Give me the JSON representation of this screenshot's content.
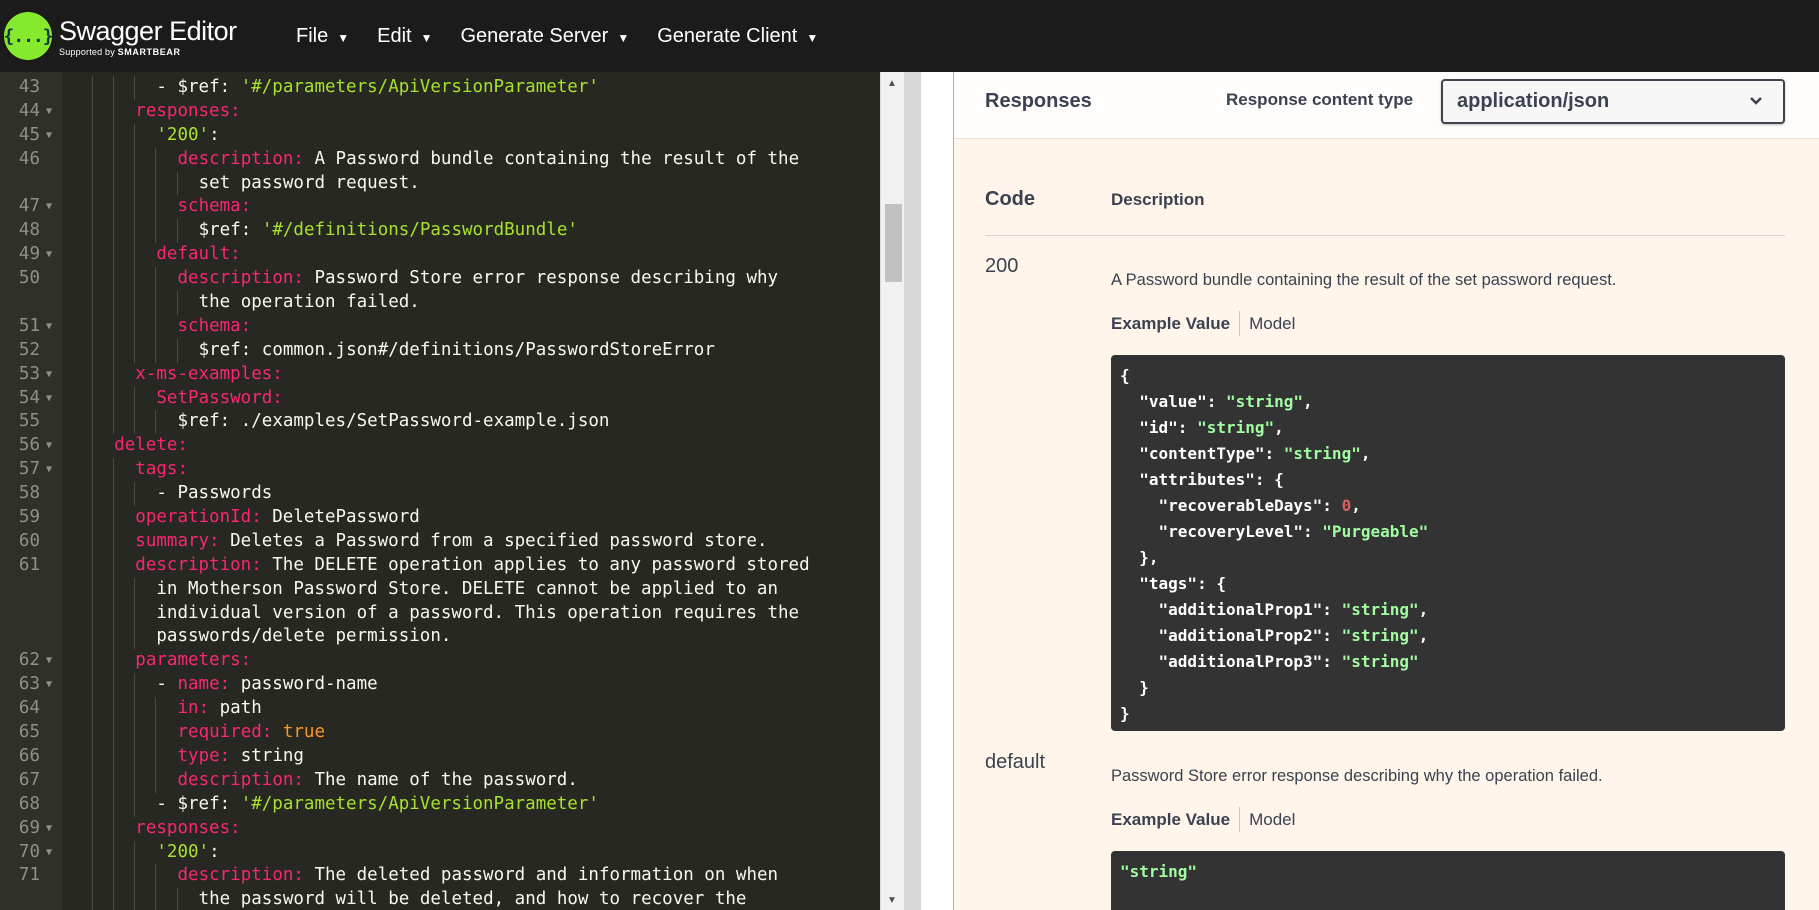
{
  "app": {
    "logo_glyph": "{...}",
    "title": "Swagger Editor",
    "supported_by": "Supported by",
    "brand": "SMARTBEAR",
    "accent_color": "#85ea2d"
  },
  "menu": [
    {
      "label": "File"
    },
    {
      "label": "Edit"
    },
    {
      "label": "Generate Server"
    },
    {
      "label": "Generate Client"
    }
  ],
  "editor": {
    "lines": [
      {
        "n": "43",
        "fold": false,
        "indent": 4,
        "tokens": [
          [
            "p",
            "- $ref: "
          ],
          [
            "s",
            "'#/parameters/ApiVersionParameter'"
          ]
        ]
      },
      {
        "n": "44",
        "fold": true,
        "indent": 3,
        "tokens": [
          [
            "k",
            "responses:"
          ]
        ]
      },
      {
        "n": "45",
        "fold": true,
        "indent": 4,
        "tokens": [
          [
            "s",
            "'200'"
          ],
          [
            "p",
            ":"
          ]
        ]
      },
      {
        "n": "46",
        "fold": false,
        "indent": 5,
        "tokens": [
          [
            "k",
            "description:"
          ],
          [
            "p",
            " A Password bundle containing the result of the"
          ]
        ]
      },
      {
        "n": "",
        "fold": false,
        "indent": 6,
        "tokens": [
          [
            "p",
            "set password request."
          ]
        ]
      },
      {
        "n": "47",
        "fold": true,
        "indent": 5,
        "tokens": [
          [
            "k",
            "schema:"
          ]
        ]
      },
      {
        "n": "48",
        "fold": false,
        "indent": 6,
        "tokens": [
          [
            "p",
            "$ref: "
          ],
          [
            "s",
            "'#/definitions/PasswordBundle'"
          ]
        ]
      },
      {
        "n": "49",
        "fold": true,
        "indent": 4,
        "tokens": [
          [
            "k",
            "default:"
          ]
        ]
      },
      {
        "n": "50",
        "fold": false,
        "indent": 5,
        "tokens": [
          [
            "k",
            "description:"
          ],
          [
            "p",
            " Password Store error response describing why"
          ]
        ]
      },
      {
        "n": "",
        "fold": false,
        "indent": 6,
        "tokens": [
          [
            "p",
            "the operation failed."
          ]
        ]
      },
      {
        "n": "51",
        "fold": true,
        "indent": 5,
        "tokens": [
          [
            "k",
            "schema:"
          ]
        ]
      },
      {
        "n": "52",
        "fold": false,
        "indent": 6,
        "tokens": [
          [
            "p",
            "$ref: common.json#/definitions/PasswordStoreError"
          ]
        ]
      },
      {
        "n": "53",
        "fold": true,
        "indent": 3,
        "tokens": [
          [
            "k",
            "x-ms-examples:"
          ]
        ]
      },
      {
        "n": "54",
        "fold": true,
        "indent": 4,
        "tokens": [
          [
            "k",
            "SetPassword:"
          ]
        ]
      },
      {
        "n": "55",
        "fold": false,
        "indent": 5,
        "tokens": [
          [
            "p",
            "$ref: ./examples/SetPassword-example.json"
          ]
        ]
      },
      {
        "n": "56",
        "fold": true,
        "indent": 2,
        "tokens": [
          [
            "k",
            "delete:"
          ]
        ]
      },
      {
        "n": "57",
        "fold": true,
        "indent": 3,
        "tokens": [
          [
            "k",
            "tags:"
          ]
        ]
      },
      {
        "n": "58",
        "fold": false,
        "indent": 4,
        "tokens": [
          [
            "p",
            "- Passwords"
          ]
        ]
      },
      {
        "n": "59",
        "fold": false,
        "indent": 3,
        "tokens": [
          [
            "k",
            "operationId:"
          ],
          [
            "p",
            " DeletePassword"
          ]
        ]
      },
      {
        "n": "60",
        "fold": false,
        "indent": 3,
        "tokens": [
          [
            "k",
            "summary:"
          ],
          [
            "p",
            " Deletes a Password from a specified password store."
          ]
        ]
      },
      {
        "n": "61",
        "fold": false,
        "indent": 3,
        "tokens": [
          [
            "k",
            "description:"
          ],
          [
            "p",
            " The DELETE operation applies to any password stored"
          ]
        ]
      },
      {
        "n": "",
        "fold": false,
        "indent": 4,
        "tokens": [
          [
            "p",
            "in Motherson Password Store. DELETE cannot be applied to an"
          ]
        ]
      },
      {
        "n": "",
        "fold": false,
        "indent": 4,
        "tokens": [
          [
            "p",
            "individual version of a password. This operation requires the"
          ]
        ]
      },
      {
        "n": "",
        "fold": false,
        "indent": 4,
        "tokens": [
          [
            "p",
            "passwords/delete permission."
          ]
        ]
      },
      {
        "n": "62",
        "fold": true,
        "indent": 3,
        "tokens": [
          [
            "k",
            "parameters:"
          ]
        ]
      },
      {
        "n": "63",
        "fold": true,
        "indent": 4,
        "tokens": [
          [
            "p",
            "- "
          ],
          [
            "k",
            "name:"
          ],
          [
            "p",
            " password-name"
          ]
        ]
      },
      {
        "n": "64",
        "fold": false,
        "indent": 5,
        "tokens": [
          [
            "k",
            "in:"
          ],
          [
            "p",
            " path"
          ]
        ]
      },
      {
        "n": "65",
        "fold": false,
        "indent": 5,
        "tokens": [
          [
            "k",
            "required:"
          ],
          [
            "b",
            " true"
          ]
        ]
      },
      {
        "n": "66",
        "fold": false,
        "indent": 5,
        "tokens": [
          [
            "k",
            "type:"
          ],
          [
            "p",
            " string"
          ]
        ]
      },
      {
        "n": "67",
        "fold": false,
        "indent": 5,
        "tokens": [
          [
            "k",
            "description:"
          ],
          [
            "p",
            " The name of the password."
          ]
        ]
      },
      {
        "n": "68",
        "fold": false,
        "indent": 4,
        "tokens": [
          [
            "p",
            "- $ref: "
          ],
          [
            "s",
            "'#/parameters/ApiVersionParameter'"
          ]
        ]
      },
      {
        "n": "69",
        "fold": true,
        "indent": 3,
        "tokens": [
          [
            "k",
            "responses:"
          ]
        ]
      },
      {
        "n": "70",
        "fold": true,
        "indent": 4,
        "tokens": [
          [
            "s",
            "'200'"
          ],
          [
            "p",
            ":"
          ]
        ]
      },
      {
        "n": "71",
        "fold": false,
        "indent": 5,
        "tokens": [
          [
            "k",
            "description:"
          ],
          [
            "p",
            " The deleted password and information on when"
          ]
        ]
      },
      {
        "n": "",
        "fold": false,
        "indent": 6,
        "tokens": [
          [
            "p",
            "the password will be deleted, and how to recover the"
          ]
        ]
      }
    ]
  },
  "responses": {
    "title": "Responses",
    "content_type_label": "Response content type",
    "content_type_value": "application/json",
    "col_code": "Code",
    "col_description": "Description",
    "example_tab": "Example Value",
    "model_tab": "Model",
    "rows": [
      {
        "code": "200",
        "description": "A Password bundle containing the result of the set password request.",
        "example_lines": [
          [
            [
              "p",
              "{"
            ]
          ],
          [
            [
              "p",
              "  "
            ],
            [
              "k",
              "\"value\""
            ],
            [
              "p",
              ": "
            ],
            [
              "s",
              "\"string\""
            ],
            [
              "p",
              ","
            ]
          ],
          [
            [
              "p",
              "  "
            ],
            [
              "k",
              "\"id\""
            ],
            [
              "p",
              ": "
            ],
            [
              "s",
              "\"string\""
            ],
            [
              "p",
              ","
            ]
          ],
          [
            [
              "p",
              "  "
            ],
            [
              "k",
              "\"contentType\""
            ],
            [
              "p",
              ": "
            ],
            [
              "s",
              "\"string\""
            ],
            [
              "p",
              ","
            ]
          ],
          [
            [
              "p",
              "  "
            ],
            [
              "k",
              "\"attributes\""
            ],
            [
              "p",
              ": {"
            ]
          ],
          [
            [
              "p",
              "    "
            ],
            [
              "k",
              "\"recoverableDays\""
            ],
            [
              "p",
              ": "
            ],
            [
              "n",
              "0"
            ],
            [
              "p",
              ","
            ]
          ],
          [
            [
              "p",
              "    "
            ],
            [
              "k",
              "\"recoveryLevel\""
            ],
            [
              "p",
              ": "
            ],
            [
              "s",
              "\"Purgeable\""
            ]
          ],
          [
            [
              "p",
              "  },"
            ]
          ],
          [
            [
              "p",
              "  "
            ],
            [
              "k",
              "\"tags\""
            ],
            [
              "p",
              ": {"
            ]
          ],
          [
            [
              "p",
              "    "
            ],
            [
              "k",
              "\"additionalProp1\""
            ],
            [
              "p",
              ": "
            ],
            [
              "s",
              "\"string\""
            ],
            [
              "p",
              ","
            ]
          ],
          [
            [
              "p",
              "    "
            ],
            [
              "k",
              "\"additionalProp2\""
            ],
            [
              "p",
              ": "
            ],
            [
              "s",
              "\"string\""
            ],
            [
              "p",
              ","
            ]
          ],
          [
            [
              "p",
              "    "
            ],
            [
              "k",
              "\"additionalProp3\""
            ],
            [
              "p",
              ": "
            ],
            [
              "s",
              "\"string\""
            ]
          ],
          [
            [
              "p",
              "  }"
            ]
          ],
          [
            [
              "p",
              "}"
            ]
          ]
        ]
      },
      {
        "code": "default",
        "description": "Password Store error response describing why the operation failed.",
        "example_lines": [
          [
            [
              "s",
              "\"string\""
            ]
          ]
        ]
      }
    ]
  }
}
